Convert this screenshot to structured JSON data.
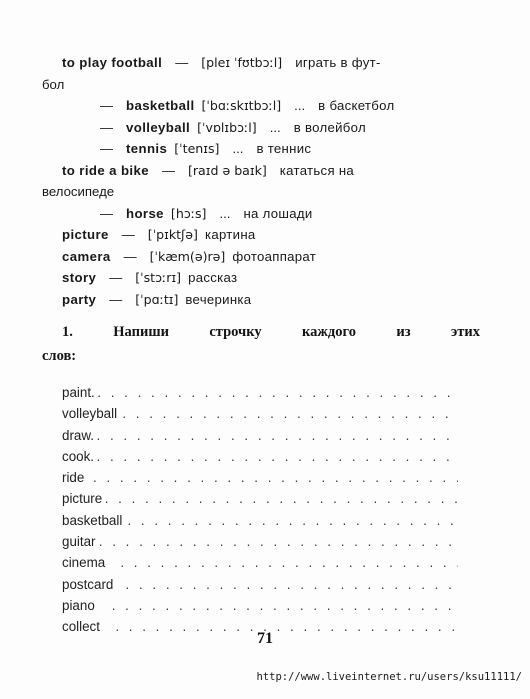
{
  "page": {
    "number": "71",
    "watermark_url": "http://www.liveinternet.ru/users/ksu11111/"
  },
  "vocabulary": [
    {
      "headword": "to play football",
      "dash": "—",
      "ipa": "[pleɪ ˈfʊtbɔːl]",
      "gloss": "играть в фут-",
      "continuation": "бол",
      "style": "entry"
    },
    {
      "headword": "basketball",
      "bullet": "—",
      "ipa": "[ˈbɑːskɪtbɔːl]",
      "ellipsis": "...",
      "gloss": "в баскетбол",
      "style": "sub"
    },
    {
      "headword": "volleyball",
      "bullet": "—",
      "ipa": "[ˈvɒlɪbɔːl]",
      "ellipsis": "...",
      "gloss": "в волейбол",
      "style": "sub"
    },
    {
      "headword": "tennis",
      "bullet": "—",
      "ipa": "[ˈtenɪs]",
      "ellipsis": "...",
      "gloss": "в теннис",
      "style": "sub"
    },
    {
      "headword": "to ride a bike",
      "dash": "—",
      "ipa": "[raɪd ə baɪk]",
      "gloss": "кататься на",
      "continuation": "велосипеде",
      "style": "entry"
    },
    {
      "headword": "horse",
      "bullet": "—",
      "ipa": "[hɔːs]",
      "ellipsis": "...",
      "gloss": "на лошади",
      "style": "sub"
    },
    {
      "headword": "picture",
      "dash": "—",
      "ipa": "[ˈpɪktʃə]",
      "gloss": "картина",
      "style": "entry-simple"
    },
    {
      "headword": "camera",
      "dash": "—",
      "ipa": "[ˈkæm(ə)rə]",
      "gloss": "фотоаппарат",
      "style": "entry-simple"
    },
    {
      "headword": "story",
      "dash": "—",
      "ipa": "[ˈstɔːrɪ]",
      "gloss": "рассказ",
      "style": "entry-simple"
    },
    {
      "headword": "party",
      "dash": "—",
      "ipa": "[ˈpɑːtɪ]",
      "gloss": "вечеринка",
      "style": "entry-simple"
    }
  ],
  "exercise": {
    "number": "1.",
    "line1_words": [
      "Напиши",
      "строчку",
      "каждого",
      "из",
      "этих"
    ],
    "line2": "слов:"
  },
  "word_practice_list": [
    {
      "word": "paint.",
      "dots": ". . . . . . . . . . . . . . . . . . . . . . . . . . . . . . . . . . . ."
    },
    {
      "word": "volleyball",
      "dots": ". . . . . . . . . . . . . . . . . . . . . . . . . . . . . . . . . . . ."
    },
    {
      "word": "draw.",
      "dots": ". . . . . . . . . . . . . . . . . . . . . . . . . . . . . . . . . . . ."
    },
    {
      "word": "cook.",
      "dots": ". . . . . . . . . . . . . . . . . . . . . . . . . . . . . . . . . . . ."
    },
    {
      "word": "ride",
      "dots": ". . . . . . . . . . . . . . . . . . . . . . . . . . . . . . . . . . . ."
    },
    {
      "word": "picture",
      "dots": ". . . . . . . . . . . . . . . . . . . . . . . . . . . . . . . . . . . ."
    },
    {
      "word": "basketball",
      "dots": ". . . . . . . . . . . . . . . . . . . . . . . . . . . . . . . . . . . ."
    },
    {
      "word": "guitar",
      "dots": ". . . . . . . . . . . . . . . . . . . . . . . . . . . . . . . . . . . ."
    },
    {
      "word": "cinema",
      "dots": ". . . . . . . . . . . . . . . . . . . . . . . . . . . . . . . . . . . ."
    },
    {
      "word": "postcard",
      "dots": ". . . . . . . . . . . . . . . . . . . . . . . . . . . . . . . . . . . ."
    },
    {
      "word": "piano",
      "dots": ". . . . . . . . . . . . . . . . . . . . . . . . . . . . . . . . . . . ."
    },
    {
      "word": "collect",
      "dots": ". . . . . . . . . . . . . . . . . . . . . . . . . . . . . . . . . . . ."
    }
  ]
}
